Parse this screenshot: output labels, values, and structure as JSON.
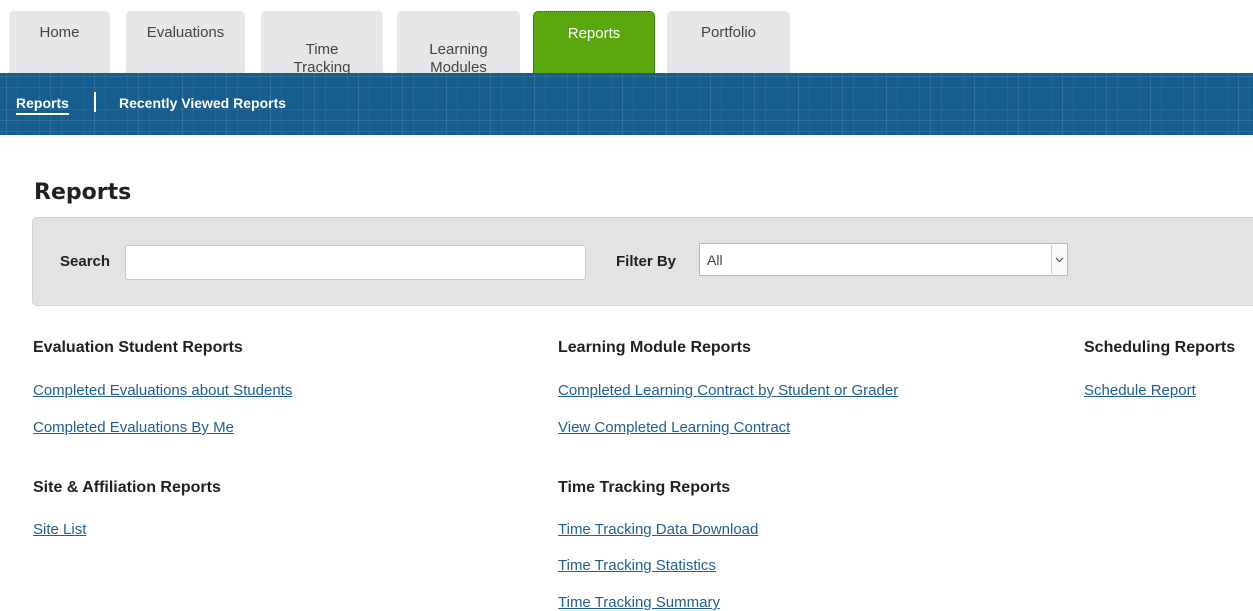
{
  "tabs": [
    {
      "label": "Home",
      "active": false
    },
    {
      "label": "Evaluations",
      "active": false
    },
    {
      "label": "Time\nTracking",
      "active": false
    },
    {
      "label": "Learning\nModules",
      "active": false
    },
    {
      "label": "Reports",
      "active": true
    },
    {
      "label": "Portfolio",
      "active": false
    }
  ],
  "subnav": {
    "reports": "Reports",
    "recent": "Recently Viewed Reports"
  },
  "page": {
    "title": "Reports"
  },
  "search": {
    "label": "Search",
    "value": "",
    "filter_label": "Filter By",
    "filter_value": "All"
  },
  "sections": {
    "evaluation_student": {
      "heading": "Evaluation Student Reports",
      "links": [
        "Completed Evaluations about Students",
        "Completed Evaluations By Me"
      ]
    },
    "site_affiliation": {
      "heading": "Site & Affiliation Reports",
      "links": [
        "Site List"
      ]
    },
    "learning_module": {
      "heading": "Learning Module Reports",
      "links": [
        "Completed Learning Contract by Student or Grader",
        "View Completed Learning Contract"
      ]
    },
    "time_tracking": {
      "heading": "Time Tracking Reports",
      "links": [
        "Time Tracking Data Download",
        "Time Tracking Statistics",
        "Time Tracking Summary"
      ]
    },
    "scheduling": {
      "heading": "Scheduling Reports",
      "links": [
        "Schedule Report"
      ]
    }
  },
  "colors": {
    "active_tab": "#5aa70e",
    "subnav_band": "#175d8e",
    "link": "#1f5f97"
  }
}
